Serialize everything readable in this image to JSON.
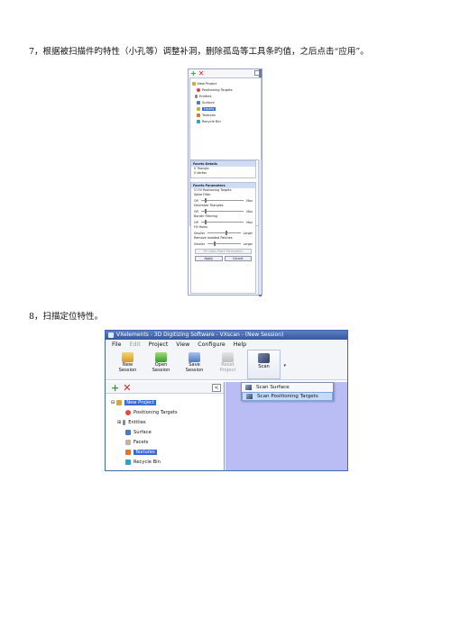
{
  "steps": {
    "step7": "7，根据被扫描件旳特性（小孔等）调整补洞，删除孤岛等工具条旳值，之后点击“应用”。",
    "step8": "8，扫描定位特性。"
  },
  "panel_small": {
    "tree": [
      "New Project",
      "Positioning Targets",
      "Entities",
      "Surface",
      "Facets",
      "Textures",
      "Recycle Bin"
    ],
    "facets_details": {
      "header": "Facets Details",
      "rows": [
        "0 Triangle",
        "0 Vertex"
      ]
    },
    "facets_params": {
      "header": "Facets Parameters",
      "checkbox": "Fill Positioning Targets",
      "groups": [
        {
          "title": "Spike Filter",
          "min": "Off",
          "max": "Max"
        },
        {
          "title": "Decimate Triangles",
          "min": "Off",
          "max": "Max"
        },
        {
          "title": "Border Filtering",
          "min": "Off",
          "max": "Max"
        },
        {
          "title": "Fill Holes",
          "min": "Smaller",
          "max": "Larger"
        },
        {
          "title": "Remove Isolated Patches",
          "min": "Smaller",
          "max": "Larger"
        }
      ],
      "disabled_button": "Fill Holes Patch Parameters",
      "apply": "Apply",
      "cancel": "Cancel"
    }
  },
  "window": {
    "title": "VXelements - 3D Digitizing Software - VXscan - (New Session)",
    "menu": [
      {
        "label": "File",
        "disabled": false
      },
      {
        "label": "Edit",
        "disabled": true
      },
      {
        "label": "Project",
        "disabled": false
      },
      {
        "label": "View",
        "disabled": false
      },
      {
        "label": "Configure",
        "disabled": false
      },
      {
        "label": "Help",
        "disabled": false
      }
    ],
    "toolbar": {
      "new": "New\nSession",
      "open": "Open\nSession",
      "save": "Save\nSession",
      "reset": "Reset\nProject",
      "scan": "Scan"
    },
    "tree": {
      "root": "New Project",
      "items": [
        "Positioning Targets",
        "Entities",
        "Surface",
        "Facets",
        "Textures",
        "Recycle Bin"
      ]
    },
    "collapse_glyph": "<",
    "scan_menu": [
      "Scan Surface",
      "Scan Positioning Targets"
    ]
  },
  "colors": {
    "title_bar": "#3e63ad",
    "viewport": "#b9bdf4",
    "selection": "#3969d6",
    "menu_highlight": "#c9daf6"
  }
}
